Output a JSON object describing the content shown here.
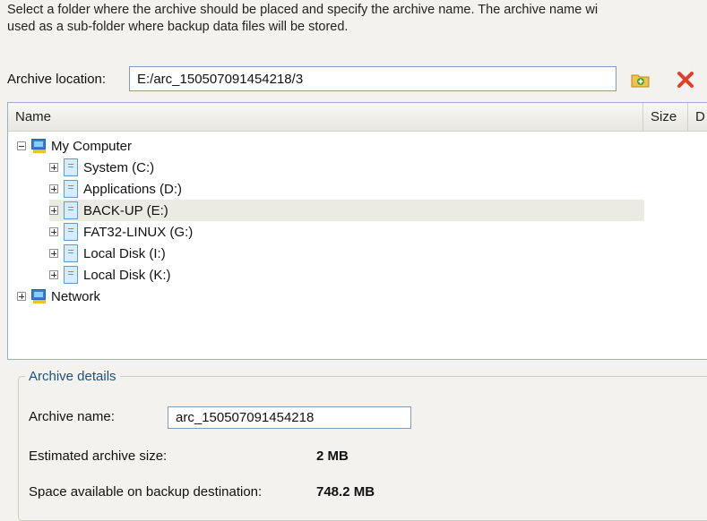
{
  "instructions": {
    "line1": "Select a folder where the archive should be placed and specify the archive name. The archive name wi",
    "line2": "used as a sub-folder where backup data files will be stored."
  },
  "location": {
    "label": "Archive location:",
    "value": "E:/arc_150507091454218/3"
  },
  "toolbar": {
    "new_folder_icon": "new-folder-icon",
    "delete_icon": "delete-icon"
  },
  "tree": {
    "columns": [
      "Name",
      "Size",
      "D"
    ],
    "root": "My Computer",
    "drives": [
      {
        "label": "System (C:)"
      },
      {
        "label": "Applications (D:)"
      },
      {
        "label": "BACK-UP (E:)",
        "selected": true
      },
      {
        "label": "FAT32-LINUX (G:)"
      },
      {
        "label": "Local Disk (I:)"
      },
      {
        "label": "Local Disk (K:)"
      }
    ],
    "network": "Network"
  },
  "details": {
    "title": "Archive details",
    "name_label": "Archive name:",
    "name_value": "arc_150507091454218",
    "size_label": "Estimated archive size:",
    "size_value": "2 MB",
    "space_label": "Space available on backup destination:",
    "space_value": "748.2 MB"
  },
  "colors": {
    "accent": "#1c5180",
    "selection": "#ecebe3",
    "delete": "#e0402a",
    "new_folder": "#f0b02a"
  }
}
